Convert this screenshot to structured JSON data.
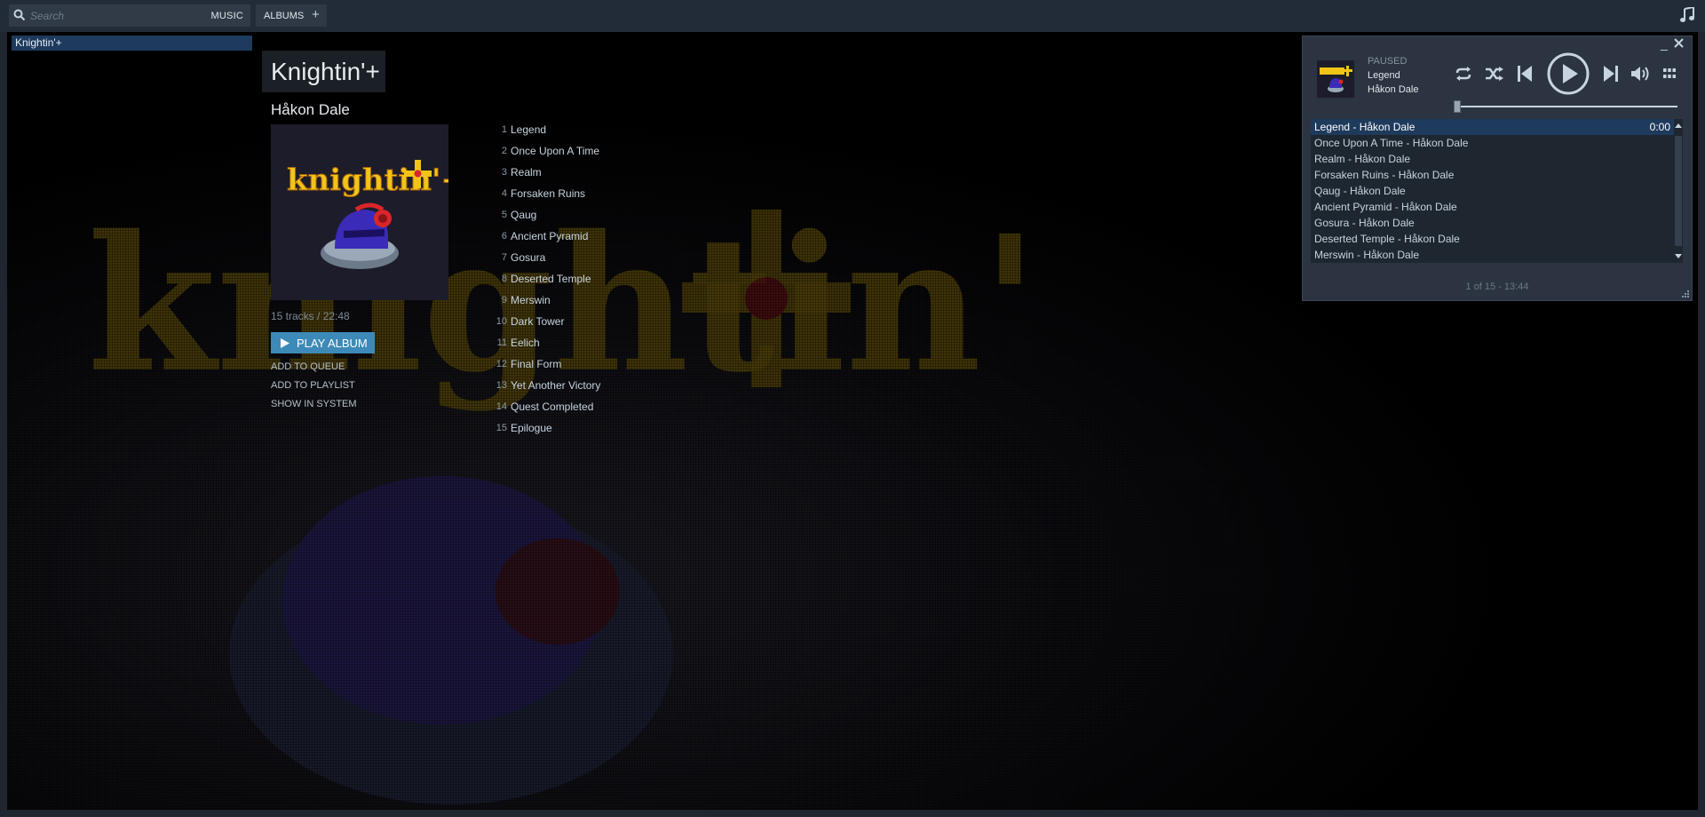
{
  "topbar": {
    "search_placeholder": "Search",
    "music_label": "MUSIC",
    "albums_label": "ALBUMS",
    "add_label": "+"
  },
  "sidebar": {
    "items": [
      {
        "label": "Knightin'+"
      }
    ]
  },
  "album": {
    "title": "Knightin'+",
    "artist": "Håkon Dale",
    "cover_text": "knightin'+",
    "summary": "15 tracks / 22:48",
    "play_label": "PLAY ALBUM",
    "actions": [
      "ADD TO QUEUE",
      "ADD TO PLAYLIST",
      "SHOW IN SYSTEM"
    ],
    "tracks": [
      {
        "num": "1",
        "title": "Legend"
      },
      {
        "num": "2",
        "title": "Once Upon A Time"
      },
      {
        "num": "3",
        "title": "Realm"
      },
      {
        "num": "4",
        "title": "Forsaken Ruins"
      },
      {
        "num": "5",
        "title": "Qaug"
      },
      {
        "num": "6",
        "title": "Ancient Pyramid"
      },
      {
        "num": "7",
        "title": "Gosura"
      },
      {
        "num": "8",
        "title": "Deserted Temple"
      },
      {
        "num": "9",
        "title": "Merswin"
      },
      {
        "num": "10",
        "title": "Dark Tower"
      },
      {
        "num": "11",
        "title": "Eelich"
      },
      {
        "num": "12",
        "title": "Final Form"
      },
      {
        "num": "13",
        "title": "Yet Another Victory"
      },
      {
        "num": "14",
        "title": "Quest Completed"
      },
      {
        "num": "15",
        "title": "Epilogue"
      }
    ]
  },
  "player": {
    "status": "PAUSED",
    "track": "Legend",
    "artist": "Håkon Dale",
    "current_time": "0:00",
    "footer": "1 of 15 - 13:44",
    "minimize_label": "_",
    "queue": [
      "Legend - Håkon Dale",
      "Once Upon A Time - Håkon Dale",
      "Realm - Håkon Dale",
      "Forsaken Ruins - Håkon Dale",
      "Qaug - Håkon Dale",
      "Ancient Pyramid - Håkon Dale",
      "Gosura - Håkon Dale",
      "Deserted Temple - Håkon Dale",
      "Merswin - Håkon Dale"
    ],
    "progress_fraction": 0
  },
  "colors": {
    "accent": "#3d8ab8",
    "selection": "#1e3a5c",
    "logo_yellow": "#f2c417",
    "logo_red": "#d9262a",
    "helmet_blue": "#3a2bb8"
  },
  "icons": [
    "search-icon",
    "music-note-icon",
    "repeat-icon",
    "shuffle-icon",
    "previous-icon",
    "play-icon",
    "next-icon",
    "volume-icon",
    "grid-icon",
    "close-icon"
  ]
}
